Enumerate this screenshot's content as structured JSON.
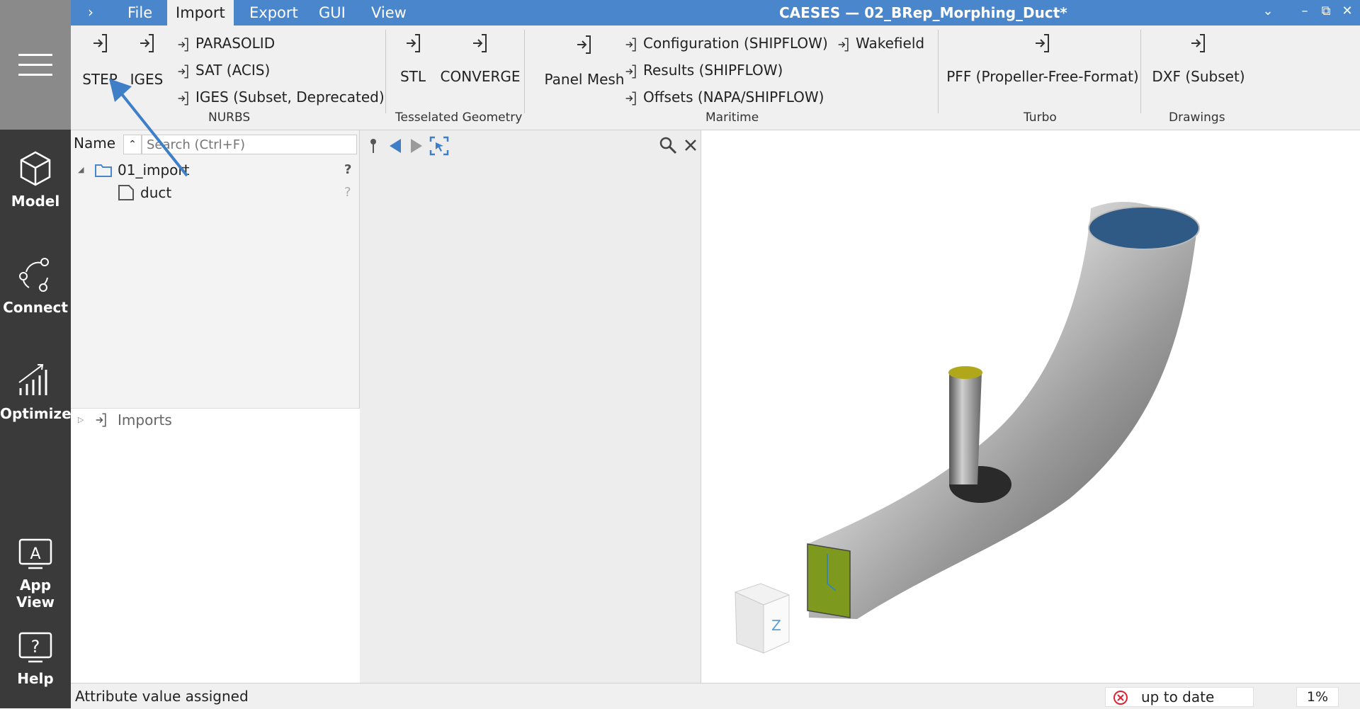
{
  "window": {
    "title": "CAESES — 02_BRep_Morphing_Duct*",
    "expand_glyph": "›",
    "controls": [
      "⌄",
      "–",
      "⧉",
      "✕"
    ]
  },
  "menu": {
    "items": [
      "File",
      "Import",
      "Export",
      "GUI",
      "View"
    ],
    "active": "Import"
  },
  "sidebar": {
    "items": [
      {
        "label": "Model",
        "icon": "cube-icon"
      },
      {
        "label": "Connect",
        "icon": "connect-icon"
      },
      {
        "label": "Optimize",
        "icon": "chart-icon"
      },
      {
        "label": "App View",
        "icon": "app-view-icon"
      },
      {
        "label": "Help",
        "icon": "help-icon"
      }
    ]
  },
  "ribbon": {
    "nurbs": {
      "group": "NURBS",
      "big": [
        "STEP",
        "IGES"
      ],
      "small": [
        "PARASOLID",
        "SAT (ACIS)",
        "IGES (Subset, Deprecated)"
      ]
    },
    "tess": {
      "group": "Tesselated Geometry",
      "big": [
        "STL",
        "CONVERGE"
      ]
    },
    "maritime": {
      "group": "Maritime",
      "big": [
        "Panel Mesh"
      ],
      "small": [
        "Configuration (SHIPFLOW)",
        "Results (SHIPFLOW)",
        "Offsets (NAPA/SHIPFLOW)",
        "Wakefield"
      ]
    },
    "turbo": {
      "group": "Turbo",
      "big": [
        "PFF (Propeller-Free-Format)"
      ]
    },
    "drawings": {
      "group": "Drawings",
      "big": [
        "DXF (Subset)"
      ]
    }
  },
  "tree": {
    "header": "Name",
    "search_placeholder": "Search (Ctrl+F)",
    "rows": [
      {
        "label": "01_import",
        "status": "?"
      },
      {
        "label": "duct",
        "status": "?"
      }
    ],
    "imports_label": "Imports"
  },
  "viewport": {
    "cube_face": "Z",
    "colors": {
      "duct": "#a8a8a8",
      "face_green": "#7d9a1e",
      "face_blue": "#2f5a85",
      "pipe_top": "#b0a81a"
    }
  },
  "status": {
    "message": "Attribute value assigned",
    "state": "up to date",
    "percent": "1%"
  }
}
